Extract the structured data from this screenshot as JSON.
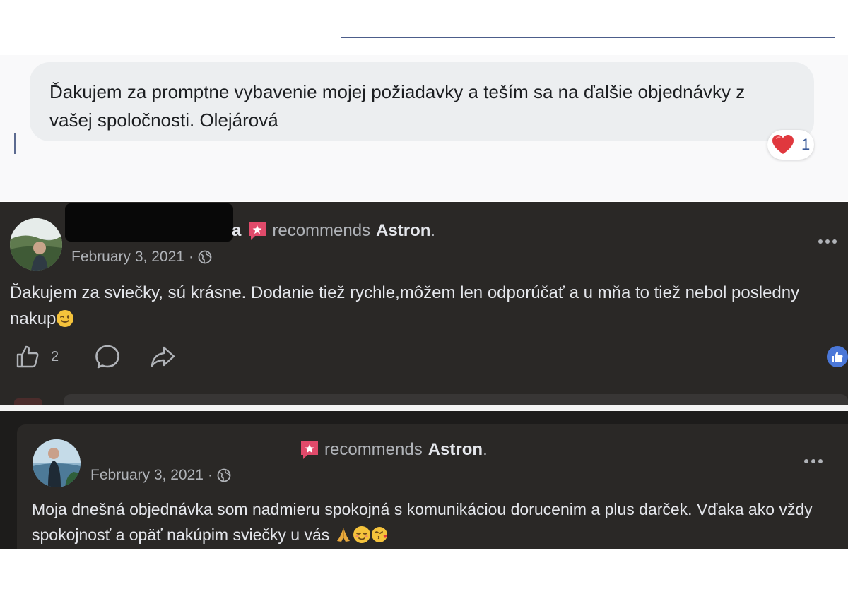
{
  "message": {
    "text": "Ďakujem za promptne vybavenie mojej požiadavky a teším sa na ďalšie objednávky z vašej spoločnosti. Olejárová",
    "reaction_icon": "heart-icon",
    "reaction_count": "1",
    "reaction_color": "#e0383e"
  },
  "reviews": [
    {
      "name_visible": "a",
      "recommends_label": "recommends",
      "page_name": "Astron",
      "period": ".",
      "date": "February 3, 2021",
      "separator": "·",
      "audience_icon": "globe-icon",
      "text": "Ďakujem za sviečky, sú krásne. Dodanie tiež rychle,môžem len odporúčať a u mňa to tiež nebol posledny nakup",
      "emojis": [
        "wink-emoji"
      ],
      "like_count": "2",
      "actions": [
        "like-icon",
        "comment-icon",
        "share-icon"
      ]
    },
    {
      "recommends_label": "recommends",
      "page_name": "Astron",
      "period": ".",
      "date": "February 3, 2021",
      "separator": "·",
      "audience_icon": "globe-icon",
      "text": "Moja dnešná objednávka som nadmieru spokojná s komunikáciou dorucenim a plus darček. Vďaka ako vždy spokojnosť a opäť nakúpim sviečky u vás",
      "emojis": [
        "folded-hands-emoji",
        "relieved-emoji",
        "kiss-emoji"
      ]
    }
  ],
  "colors": {
    "dark_card": "#2a2826",
    "text_primary": "#e4e6eb",
    "text_secondary": "#b0b3b8",
    "recommend_badge": "#e04a6a",
    "like_blue": "#4a77d8"
  }
}
